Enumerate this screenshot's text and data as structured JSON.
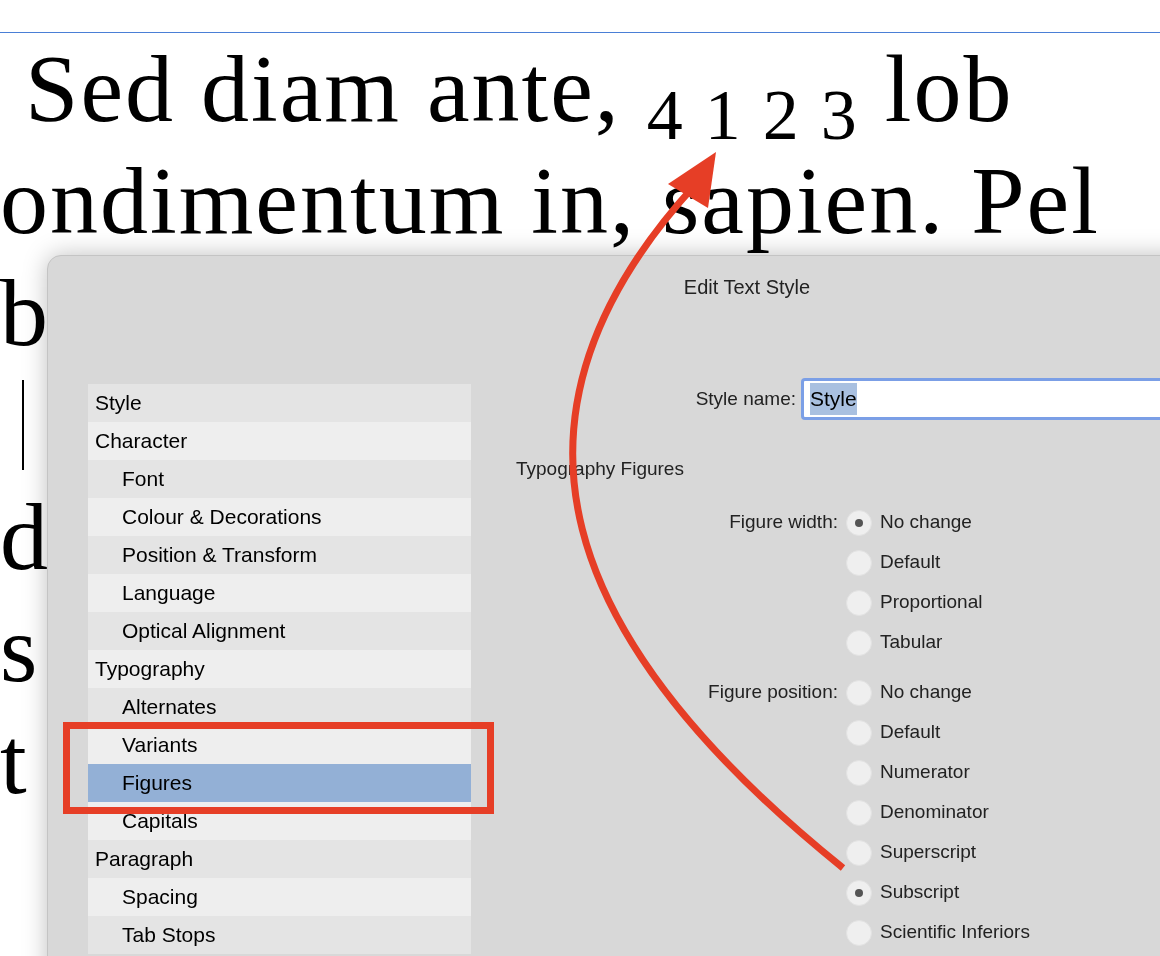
{
  "document": {
    "lines": [
      {
        "text": "Sed diam ante, $_{4 1 2 3}$ lob",
        "cursor_before": false
      },
      {
        "text": "ondimentum in, sapien. Pel",
        "cursor_before": false
      },
      {
        "text": "b",
        "cursor_before": false
      },
      {
        "cursor_before": true
      },
      {
        "text": "d",
        "cursor_before": false
      },
      {
        "text": "s",
        "cursor_before": false
      },
      {
        "text": "t",
        "cursor_before": false
      }
    ]
  },
  "dialog": {
    "title": "Edit Text Style",
    "sidebar": {
      "items": [
        {
          "label": "Style",
          "selected": false
        },
        {
          "label": "Character",
          "selected": false,
          "children": [
            {
              "label": "Font",
              "selected": false
            },
            {
              "label": "Colour & Decorations",
              "selected": false
            },
            {
              "label": "Position & Transform",
              "selected": false
            },
            {
              "label": "Language",
              "selected": false
            },
            {
              "label": "Optical Alignment",
              "selected": false
            }
          ]
        },
        {
          "label": "Typography",
          "selected": false,
          "children": [
            {
              "label": "Alternates",
              "selected": false
            },
            {
              "label": "Variants",
              "selected": false
            },
            {
              "label": "Figures",
              "selected": true
            },
            {
              "label": "Capitals",
              "selected": false
            }
          ]
        },
        {
          "label": "Paragraph",
          "selected": false,
          "children": [
            {
              "label": "Spacing",
              "selected": false
            },
            {
              "label": "Tab Stops",
              "selected": false
            }
          ]
        }
      ]
    },
    "style_name": {
      "label": "Style name:",
      "value": "Style"
    },
    "section_title": "Typography Figures",
    "radio_groups": [
      {
        "label": "Figure width:",
        "options": [
          {
            "label": "No change",
            "selected": true
          },
          {
            "label": "Default",
            "selected": false
          },
          {
            "label": "Proportional",
            "selected": false
          },
          {
            "label": "Tabular",
            "selected": false
          }
        ]
      },
      {
        "label": "Figure position:",
        "options": [
          {
            "label": "No change",
            "selected": false
          },
          {
            "label": "Default",
            "selected": false
          },
          {
            "label": "Numerator",
            "selected": false
          },
          {
            "label": "Denominator",
            "selected": false
          },
          {
            "label": "Superscript",
            "selected": false
          },
          {
            "label": "Subscript",
            "selected": true
          },
          {
            "label": "Scientific Inferiors",
            "selected": false
          }
        ]
      }
    ]
  }
}
